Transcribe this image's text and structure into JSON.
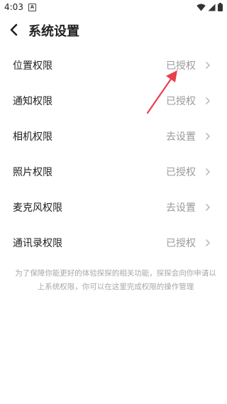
{
  "status_bar": {
    "time": "4:03",
    "notification_letter": "A",
    "icons": [
      "wifi-icon",
      "signal-icon",
      "battery-icon"
    ]
  },
  "header": {
    "title": "系统设置",
    "back_icon": "chevron-left-icon"
  },
  "permissions": [
    {
      "label": "位置权限",
      "status": "已授权"
    },
    {
      "label": "通知权限",
      "status": "已授权"
    },
    {
      "label": "相机权限",
      "status": "去设置"
    },
    {
      "label": "照片权限",
      "status": "已授权"
    },
    {
      "label": "麦克风权限",
      "status": "去设置"
    },
    {
      "label": "通讯录权限",
      "status": "已授权"
    }
  ],
  "note": "为了保障你能更好的体验探探的相关功能，探探会向你申请以上系统权限，你可以在这里完成权限的操作管理",
  "colors": {
    "annotation_arrow": "#e8404c",
    "status_text": "#9a9a9a",
    "note_text": "#a8a8a8"
  }
}
